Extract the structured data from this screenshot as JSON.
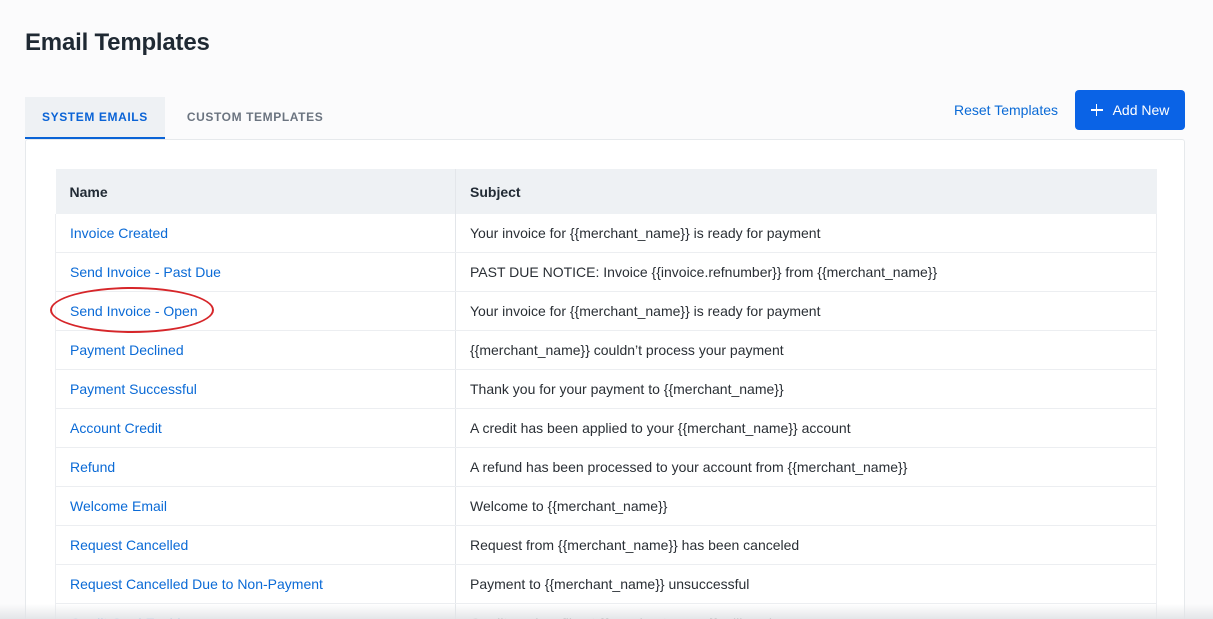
{
  "page": {
    "title": "Email Templates"
  },
  "tabs": [
    {
      "label": "SYSTEM EMAILS",
      "active": true
    },
    {
      "label": "CUSTOM TEMPLATES",
      "active": false
    }
  ],
  "actions": {
    "reset_label": "Reset Templates",
    "add_label": "Add New",
    "add_icon": "plus-icon"
  },
  "table": {
    "headers": {
      "name": "Name",
      "subject": "Subject"
    },
    "rows": [
      {
        "name": "Invoice Created",
        "subject": "Your invoice for {{merchant_name}} is ready for payment"
      },
      {
        "name": "Send Invoice - Past Due",
        "subject": "PAST DUE NOTICE: Invoice {{invoice.refnumber}} from {{merchant_name}}"
      },
      {
        "name": "Send Invoice - Open",
        "subject": "Your invoice for {{merchant_name}} is ready for payment"
      },
      {
        "name": "Payment Declined",
        "subject": "{{merchant_name}} couldn’t process your payment"
      },
      {
        "name": "Payment Successful",
        "subject": "Thank you for your payment to {{merchant_name}}"
      },
      {
        "name": "Account Credit",
        "subject": "A credit has been applied to your {{merchant_name}} account"
      },
      {
        "name": "Refund",
        "subject": "A refund has been processed to your account from {{merchant_name}}"
      },
      {
        "name": "Welcome Email",
        "subject": "Welcome to {{merchant_name}}"
      },
      {
        "name": "Request Cancelled",
        "subject": "Request from {{merchant_name}} has been canceled"
      },
      {
        "name": "Request Cancelled Due to Non-Payment",
        "subject": "Payment to {{merchant_name}} unsuccessful"
      },
      {
        "name": "Credit Card Expiring",
        "subject": "Credit card on file at {{merchant_name}} will expire"
      }
    ]
  },
  "colors": {
    "accent": "#0a63e6",
    "link": "#0a6ad6",
    "highlight": "#d6262a"
  }
}
